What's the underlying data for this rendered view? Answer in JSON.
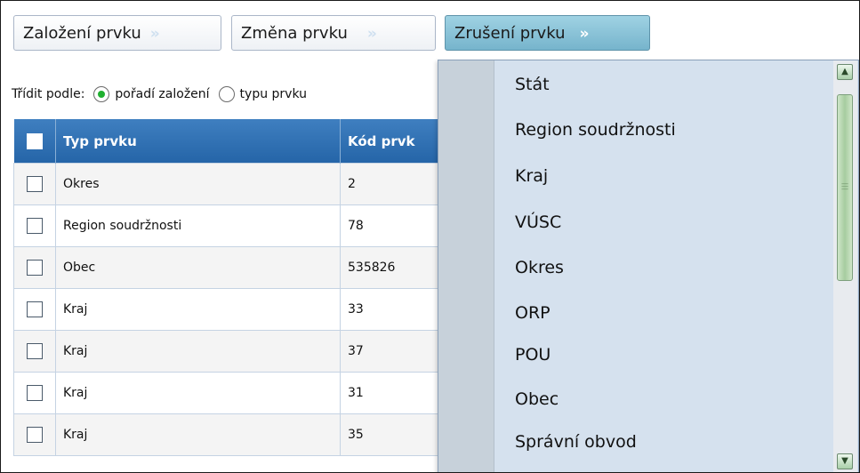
{
  "toolbar": {
    "buttons": [
      {
        "label": "Založení prvku",
        "chevron": "»"
      },
      {
        "label": "Změna prvku",
        "chevron": "»"
      },
      {
        "label": "Zrušení prvku",
        "chevron": "»"
      }
    ],
    "active_index": 2
  },
  "sort": {
    "label": "Třídit podle:",
    "options": [
      {
        "label": "pořadí založení",
        "selected": true
      },
      {
        "label": "typu prvku",
        "selected": false
      }
    ]
  },
  "table": {
    "columns": [
      "Typ prvku",
      "Kód prvk"
    ],
    "rows": [
      {
        "typ": "Okres",
        "kod": "2"
      },
      {
        "typ": "Region soudržnosti",
        "kod": "78"
      },
      {
        "typ": "Obec",
        "kod": "535826"
      },
      {
        "typ": "Kraj",
        "kod": "33"
      },
      {
        "typ": "Kraj",
        "kod": "37"
      },
      {
        "typ": "Kraj",
        "kod": "31"
      },
      {
        "typ": "Kraj",
        "kod": "35"
      }
    ]
  },
  "dropdown": {
    "items": [
      "Stát",
      "Region soudržnosti",
      "Kraj",
      "VÚSC",
      "Okres",
      "ORP",
      "POU",
      "Obec",
      "Správní obvod"
    ]
  },
  "colors": {
    "header_blue": "#2565a8",
    "active_button": "#8cc6dc",
    "menu_bg": "#d5e1ee",
    "radio_selected": "#20b030"
  },
  "icons": {
    "chevron": "double-chevron-right-icon",
    "scroll_up": "scroll-up-arrow-icon",
    "scroll_down": "scroll-down-arrow-icon"
  }
}
